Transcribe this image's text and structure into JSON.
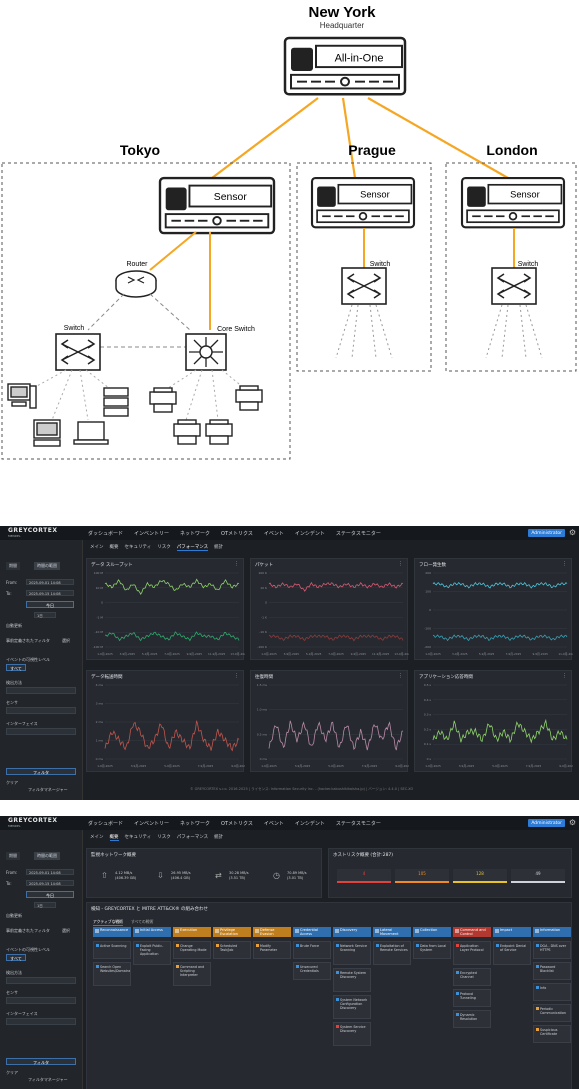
{
  "diagram": {
    "hq": {
      "title": "New York",
      "subtitle": "Headquarter",
      "device_label": "All-in-One"
    },
    "sites": [
      {
        "name": "Tokyo",
        "device_label": "Sensor"
      },
      {
        "name": "Prague",
        "device_label": "Sensor",
        "switch_label": "Switch"
      },
      {
        "name": "London",
        "device_label": "Sensor",
        "switch_label": "Switch"
      }
    ],
    "tokyo": {
      "router_label": "Router",
      "switch_label": "Switch",
      "core_switch_label": "Core Switch"
    },
    "colors": {
      "link": "#f5a623",
      "line": "#222222",
      "dash": "#999999"
    }
  },
  "app": {
    "logo_main": "GREYCORTEX",
    "logo_sub": "MENDEL",
    "nav": [
      "ダッシュボード",
      "インベントリー",
      "ネットワーク",
      "OTメトリクス",
      "イベント",
      "インシデント",
      "ステータスモニター"
    ],
    "user": "Administrator",
    "sidebar": {
      "tabs": [
        "期間",
        "時間の範囲"
      ],
      "from_label": "From:",
      "from_value": "2025-09-01 14:08",
      "to_label": "To:",
      "to_value": "2025-09-15 14:08",
      "today_button": "今日",
      "step_value": "1日",
      "auto_refresh": "自動更新",
      "saved_filter": "事前定義されたフィルタ",
      "saved_filter_action": "選択",
      "event_level": "イベントの可視性レベル",
      "level_all": "すべて",
      "detection": "検出方法",
      "sensor": "センサ",
      "interface": "インターフェイス",
      "filter_button": "フィルタ",
      "clear": "クリア",
      "filter_manager": "フィルタマネージャー"
    },
    "subtabs": [
      "メイン",
      "概要",
      "セキュリティ",
      "リスク",
      "パフォーマンス",
      "統計"
    ],
    "footer": "© GREYCORTEX s.r.o. 2016-2025 | ライセンス: Information Security Inc. - (hacker.kabushikikaisha.jp) | バージョン: 4.4.0 | SEC-XO",
    "colors": {
      "accent": "#2e7bd6",
      "bg": "#1c1f24",
      "panel": "#262a30"
    }
  },
  "chart_data": [
    {
      "type": "line",
      "title": "データ スループット",
      "ylabel": "",
      "yticks": [
        "100 M",
        "10 M",
        "0",
        "-1 M",
        "-10 M",
        "-100 M"
      ],
      "xticks": [
        "1-9月-2025",
        "3-9月-2025",
        "5-9月-2025",
        "7-9月-2025",
        "9-9月-2025",
        "11-9月-2025",
        "13-9月-2025"
      ],
      "series": [
        {
          "color": "#8fd36b",
          "values": [
            6,
            5,
            7,
            4,
            6,
            3,
            6,
            5,
            7,
            6,
            4,
            6,
            5,
            7,
            5,
            6,
            4,
            7,
            5,
            6
          ]
        },
        {
          "color": "#2fa86c",
          "values": [
            2,
            3,
            1,
            2,
            3,
            1,
            2,
            3,
            2,
            1,
            3,
            2,
            1,
            3,
            2,
            2,
            1,
            3,
            2,
            1
          ]
        }
      ]
    },
    {
      "type": "line",
      "title": "パケット",
      "yticks": [
        "100 K",
        "10 K",
        "0",
        "-1 K",
        "-10 K",
        "-100 K"
      ],
      "xticks": [
        "1-9月-2025",
        "3-9月-2025",
        "5-9月-2025",
        "7-9月-2025",
        "9-9月-2025",
        "11-9月-2025",
        "13-9月-2025"
      ],
      "series": [
        {
          "color": "#d65a72",
          "values": [
            6,
            5,
            6,
            5,
            6,
            4,
            6,
            5,
            6,
            6,
            5,
            6,
            5,
            6,
            5,
            6,
            5,
            6,
            5,
            6
          ]
        },
        {
          "color": "#8a3b3b",
          "values": [
            2,
            2,
            1,
            2,
            2,
            1,
            2,
            2,
            2,
            1,
            2,
            2,
            1,
            2,
            2,
            2,
            1,
            2,
            2,
            1
          ]
        }
      ]
    },
    {
      "type": "line",
      "title": "フロー発生数",
      "yticks": [
        "200",
        "100",
        "0",
        "-100",
        "-200"
      ],
      "xticks": [
        "1-9月-2025",
        "3-9月-2025",
        "5-9月-2025",
        "7-9月-2025",
        "9-9月-2025",
        "11-9月-2025"
      ],
      "series": [
        {
          "color": "#4fc3d9",
          "values": [
            6,
            6,
            5,
            6,
            6,
            5,
            6,
            6,
            5,
            6,
            6,
            5,
            6,
            6,
            5,
            6,
            6,
            5,
            6,
            6
          ]
        },
        {
          "color": "#3a9fb3",
          "values": [
            2,
            2,
            1,
            2,
            2,
            1,
            2,
            2,
            1,
            2,
            2,
            1,
            2,
            2,
            1,
            2,
            2,
            1,
            2,
            2
          ]
        }
      ]
    },
    {
      "type": "line",
      "title": "データ転送時間",
      "yticks": [
        "4 ms",
        "3 ms",
        "2 ms",
        "1 ms",
        "0 ms"
      ],
      "xticks": [
        "1-9月-2025",
        "3-9月-2025",
        "5-9月-2025",
        "7-9月-2025",
        "9-9月-2025"
      ],
      "series": [
        {
          "color": "#c0554d",
          "values": [
            1,
            3,
            2,
            1,
            4,
            3,
            1,
            2,
            4,
            1,
            3,
            2,
            1,
            4,
            2,
            1,
            3,
            2,
            1,
            2
          ]
        }
      ]
    },
    {
      "type": "line",
      "title": "往復時間",
      "yticks": [
        "1.5 ms",
        "1.0 ms",
        "0.5 ms",
        "0 ms"
      ],
      "xticks": [
        "1-9月-2025",
        "3-9月-2025",
        "5-9月-2025",
        "7-9月-2025",
        "9-9月-2025"
      ],
      "series": [
        {
          "color": "#b98aa8",
          "values": [
            1,
            4,
            1,
            4,
            2,
            4,
            1,
            4,
            2,
            4,
            1,
            4,
            1,
            3,
            1,
            4,
            2,
            4,
            1,
            3
          ]
        }
      ]
    },
    {
      "type": "line",
      "title": "アプリケーション応答時間",
      "yticks": [
        "0.5 s",
        "0.4 s",
        "0.3 s",
        "0.2 s",
        "0.1 s",
        "0 s"
      ],
      "xticks": [
        "1-9月-2025",
        "3-9月-2025",
        "5-9月-2025",
        "7-9月-2025",
        "9-9月-2025"
      ],
      "series": [
        {
          "color": "#8fd36b",
          "values": [
            2,
            3,
            2,
            4,
            2,
            3,
            3,
            2,
            4,
            2,
            3,
            2,
            4,
            3,
            2,
            3,
            4,
            2,
            3,
            2
          ]
        }
      ]
    }
  ],
  "overview": {
    "monitoring_title": "監視ネットワーク概要",
    "stats": [
      {
        "value": "4.12 MB/s",
        "sub": "(406.39 GB)"
      },
      {
        "value": "26.95 MB/s",
        "sub": "(406.4 GB)"
      },
      {
        "value": "30.28 MB/s",
        "sub": "(3.51 TB)"
      },
      {
        "value": "70.89 MB/s",
        "sub": "(3.01 TB)"
      }
    ],
    "hosts_title": "ホストリスク概要 (合計:287)",
    "host_counts": [
      {
        "value": "4",
        "color": "#e2423c"
      },
      {
        "value": "105",
        "color": "#f08a24"
      },
      {
        "value": "128",
        "color": "#e8c227"
      },
      {
        "value": "49",
        "color": "#cfd2d6"
      }
    ],
    "mitre_title": "検知 - GREYCORTEX と MITRE ATT&CK® の組み合わせ",
    "mitre_tabs": [
      "アクティブな戦術",
      "すべての戦術"
    ],
    "tactics": [
      "Reconnaissance",
      "Initial Access",
      "Execution",
      "Privilege Escalation",
      "Defense Evasion",
      "Credential Access",
      "Discovery",
      "Lateral Movement",
      "Collection",
      "Command and Control",
      "Impact",
      "Information"
    ],
    "techniques": [
      [
        "Active Scanning",
        "Search Open Websites/Domains"
      ],
      [
        "Exploit Public-Facing Application"
      ],
      [
        "Change Operating Mode",
        "Command and Scripting Interpreter"
      ],
      [
        "Scheduled Task/Job"
      ],
      [
        "Modify Parameter"
      ],
      [
        "Brute Force",
        "Unsecured Credentials"
      ],
      [
        "Network Service Scanning",
        "Remote System Discovery",
        "System Network Configuration Discovery",
        "System Service Discovery"
      ],
      [
        "Exploitation of Remote Services"
      ],
      [
        "Data from Local System"
      ],
      [
        "Application Layer Protocol",
        "Encrypted Channel",
        "Protocol Tunneling",
        "Dynamic Resolution"
      ],
      [
        "Endpoint Denial of Service"
      ],
      [
        "DGA - DNS over HTTPS",
        "Password Blacklist",
        "Info",
        "Periodic Communication",
        "Suspicious Certificate"
      ]
    ]
  }
}
